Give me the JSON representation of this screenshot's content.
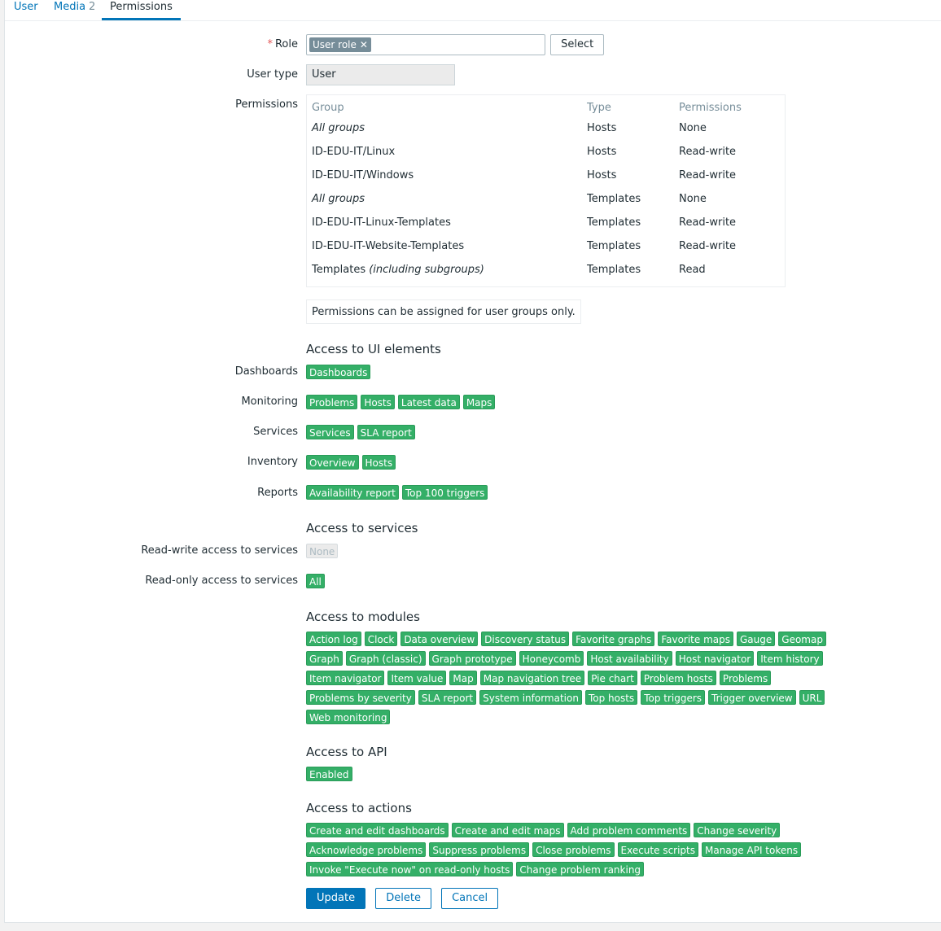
{
  "tabs": [
    {
      "label": "User"
    },
    {
      "label": "Media",
      "count": "2"
    },
    {
      "label": "Permissions"
    }
  ],
  "form": {
    "role_label": "Role",
    "role_required": "*",
    "role_value": "User role",
    "select_button": "Select",
    "user_type_label": "User type",
    "user_type_value": "User",
    "permissions_label": "Permissions",
    "permissions_note": "Permissions can be assigned for user groups only."
  },
  "permissions_table": {
    "headers": [
      "Group",
      "Type",
      "Permissions"
    ],
    "rows": [
      {
        "group": "All groups",
        "type": "Hosts",
        "perm": "None"
      },
      {
        "group": "ID-EDU-IT/Linux",
        "type": "Hosts",
        "perm": "Read-write"
      },
      {
        "group": "ID-EDU-IT/Windows",
        "type": "Hosts",
        "perm": "Read-write"
      },
      {
        "group": "All groups",
        "type": "Templates",
        "perm": "None"
      },
      {
        "group": "ID-EDU-IT-Linux-Templates",
        "type": "Templates",
        "perm": "Read-write"
      },
      {
        "group": "ID-EDU-IT-Website-Templates",
        "type": "Templates",
        "perm": "Read-write"
      },
      {
        "group": "Templates",
        "group_suffix": "(including subgroups)",
        "type": "Templates",
        "perm": "Read"
      }
    ]
  },
  "ui_elements": {
    "title": "Access to UI elements",
    "dashboards_label": "Dashboards",
    "dashboards": [
      "Dashboards"
    ],
    "monitoring_label": "Monitoring",
    "monitoring": [
      "Problems",
      "Hosts",
      "Latest data",
      "Maps"
    ],
    "services_label": "Services",
    "services": [
      "Services",
      "SLA report"
    ],
    "inventory_label": "Inventory",
    "inventory": [
      "Overview",
      "Hosts"
    ],
    "reports_label": "Reports",
    "reports": [
      "Availability report",
      "Top 100 triggers"
    ]
  },
  "services_access": {
    "title": "Access to services",
    "rw_label": "Read-write access to services",
    "rw_value": "None",
    "ro_label": "Read-only access to services",
    "ro_value": "All"
  },
  "modules": {
    "title": "Access to modules",
    "items": [
      "Action log",
      "Clock",
      "Data overview",
      "Discovery status",
      "Favorite graphs",
      "Favorite maps",
      "Gauge",
      "Geomap",
      "Graph",
      "Graph (classic)",
      "Graph prototype",
      "Honeycomb",
      "Host availability",
      "Host navigator",
      "Item history",
      "Item navigator",
      "Item value",
      "Map",
      "Map navigation tree",
      "Pie chart",
      "Problem hosts",
      "Problems",
      "Problems by severity",
      "SLA report",
      "System information",
      "Top hosts",
      "Top triggers",
      "Trigger overview",
      "URL",
      "Web monitoring"
    ]
  },
  "api": {
    "title": "Access to API",
    "value": "Enabled"
  },
  "actions": {
    "title": "Access to actions",
    "items": [
      "Create and edit dashboards",
      "Create and edit maps",
      "Add problem comments",
      "Change severity",
      "Acknowledge problems",
      "Suppress problems",
      "Close problems",
      "Execute scripts",
      "Manage API tokens",
      "Invoke \"Execute now\" on read-only hosts",
      "Change problem ranking"
    ]
  },
  "buttons": {
    "update": "Update",
    "delete": "Delete",
    "cancel": "Cancel"
  },
  "colors": {
    "accent": "#0275b8",
    "tag_green": "#34af67",
    "required": "#e45959"
  }
}
